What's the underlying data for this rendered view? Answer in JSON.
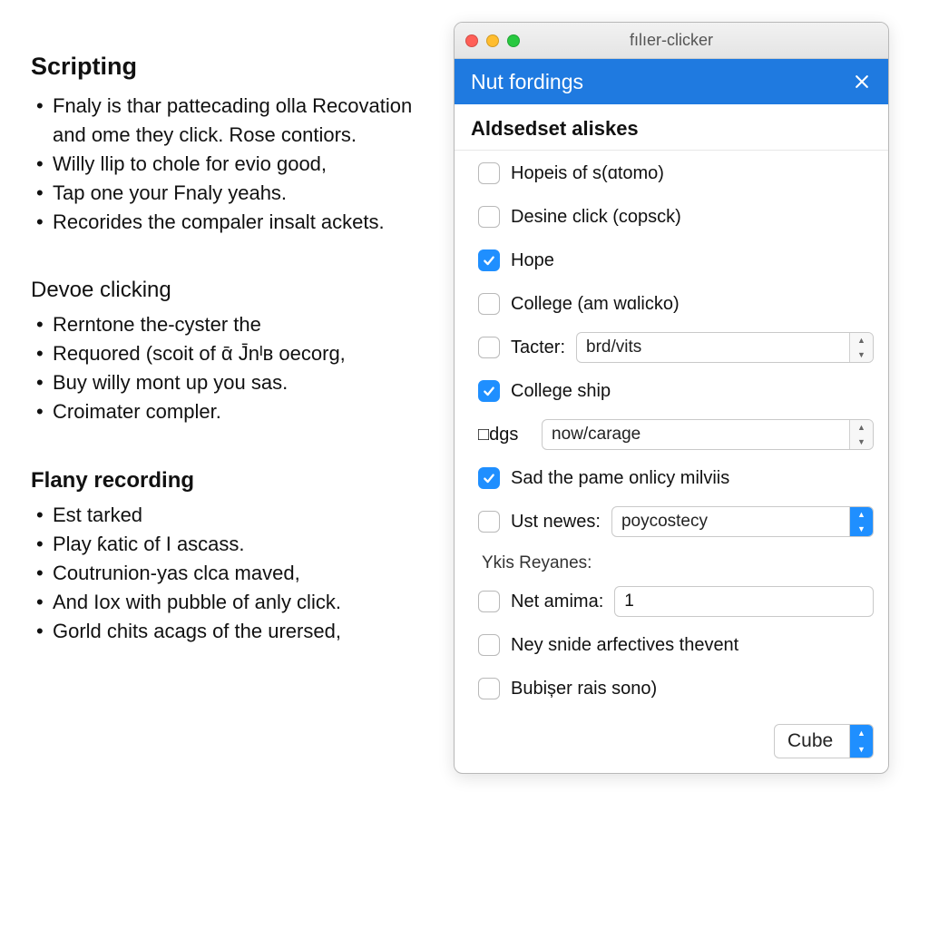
{
  "left": {
    "section1": {
      "title": "Scripting",
      "items": [
        "Fnaly is thar pattecading olla Recovation and ome they click. Rose contiors.",
        "Willy llip to chole for evio good,",
        "Tap one your Fnaly yeahs.",
        "Recorides the compaler insalt ackets."
      ]
    },
    "section2": {
      "title": "Devoe clicking",
      "items": [
        "Rerntone the-cyster the",
        "Requored (scoit of ᾱ J̄nᴵʙ oecorg,",
        "Buy willy mont up you sas.",
        "Croimater compler."
      ]
    },
    "section3": {
      "title": "Flany recording",
      "items": [
        "Est tarked",
        "Play ƙatic of I ascass.",
        "Coutrunion-yas clca maved,",
        "And Iox with pubble of anly click.",
        "Gorld chits acags of the urersed,"
      ]
    }
  },
  "window": {
    "title": "fılıer-clicker",
    "bluebar_title": "Nut fordings",
    "section_heading": "Aldsedset aliskes",
    "rows": {
      "r1": {
        "label": "Hopeis of s(ɑtomo)",
        "checked": false
      },
      "r2": {
        "label": "Desine click (copsck)",
        "checked": false
      },
      "r3": {
        "label": "Hope",
        "checked": true
      },
      "r4": {
        "label": "College (am wɑlickᴏ)",
        "checked": false
      },
      "r5": {
        "label": "Tacter:",
        "checked": false,
        "select_value": "brd/vits"
      },
      "r6": {
        "label": "College ship",
        "checked": true
      },
      "r7": {
        "label": "□dgs",
        "select_value": "now/carage"
      },
      "r8": {
        "label": "Sad the pame onlicy milviis",
        "checked": true
      },
      "r9": {
        "label": "Ust newes:",
        "checked": false,
        "select_value": "poycostecy"
      },
      "group_label": "Ykis Reyanes:",
      "r10": {
        "label": "Net amima:",
        "checked": false,
        "value": "1"
      },
      "r11": {
        "label": "Ney snide arfectives thevent",
        "checked": false
      },
      "r12": {
        "label": "Bubișer rais sono)",
        "checked": false
      }
    },
    "footer_select": "Cube"
  }
}
